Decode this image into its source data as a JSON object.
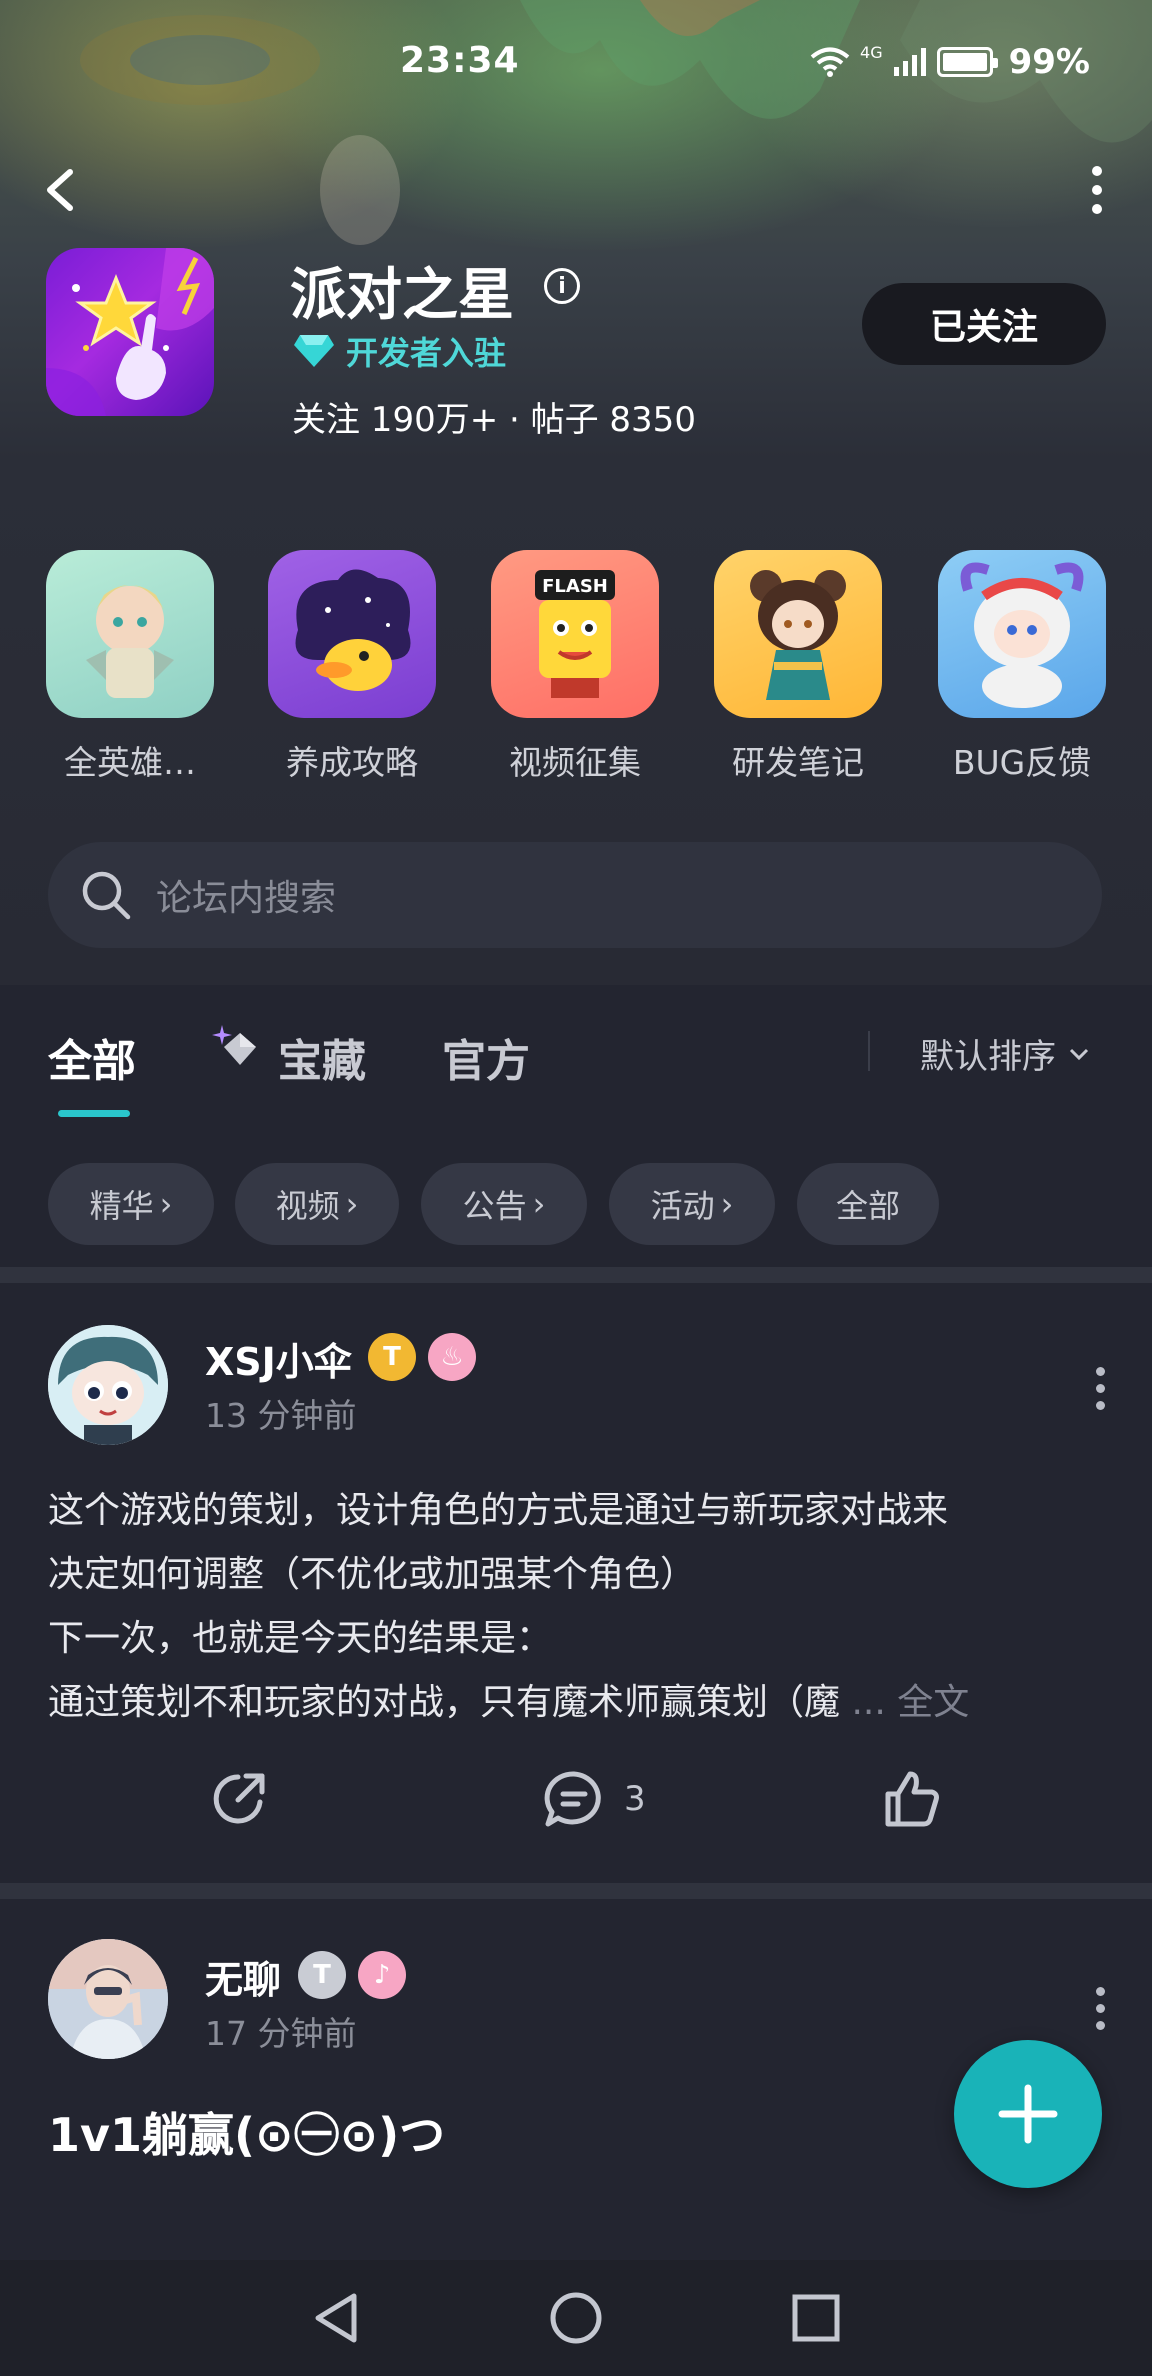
{
  "status_bar": {
    "time": "23:34",
    "network": "4G",
    "battery": "99%"
  },
  "forum": {
    "title": "派对之星",
    "developer_badge": "开发者入驻",
    "stats": "关注 190万+ · 帖子 8350",
    "follow_button": "已关注"
  },
  "shortcuts": [
    {
      "label": "全英雄…"
    },
    {
      "label": "养成攻略"
    },
    {
      "label": "视频征集"
    },
    {
      "label": "研发笔记"
    },
    {
      "label": "BUG反馈"
    }
  ],
  "search": {
    "placeholder": "论坛内搜索"
  },
  "tabs": {
    "all": "全部",
    "treasure": "宝藏",
    "official": "官方",
    "sort": "默认排序"
  },
  "chips": [
    "精华",
    "视频",
    "公告",
    "活动",
    "全部"
  ],
  "posts": [
    {
      "username": "XSJ小伞",
      "time": "13 分钟前",
      "lines": [
        "这个游戏的策划，设计角色的方式是通过与新玩家对战来",
        "决定如何调整（不优化或加强某个角色）",
        "下一次，也就是今天的结果是：",
        "通过策划不和玩家的对战，只有魔术师赢策划（魔"
      ],
      "ellipsis": "...",
      "full_text_link": "全文",
      "comment_count": "3"
    },
    {
      "username": "无聊",
      "time": "17 分钟前",
      "title": "1v1躺赢(⊙㊀⊙)つ"
    }
  ],
  "colors": {
    "accent": "#2ac6cc",
    "fab": "#19b3b8",
    "background": "#232530"
  }
}
